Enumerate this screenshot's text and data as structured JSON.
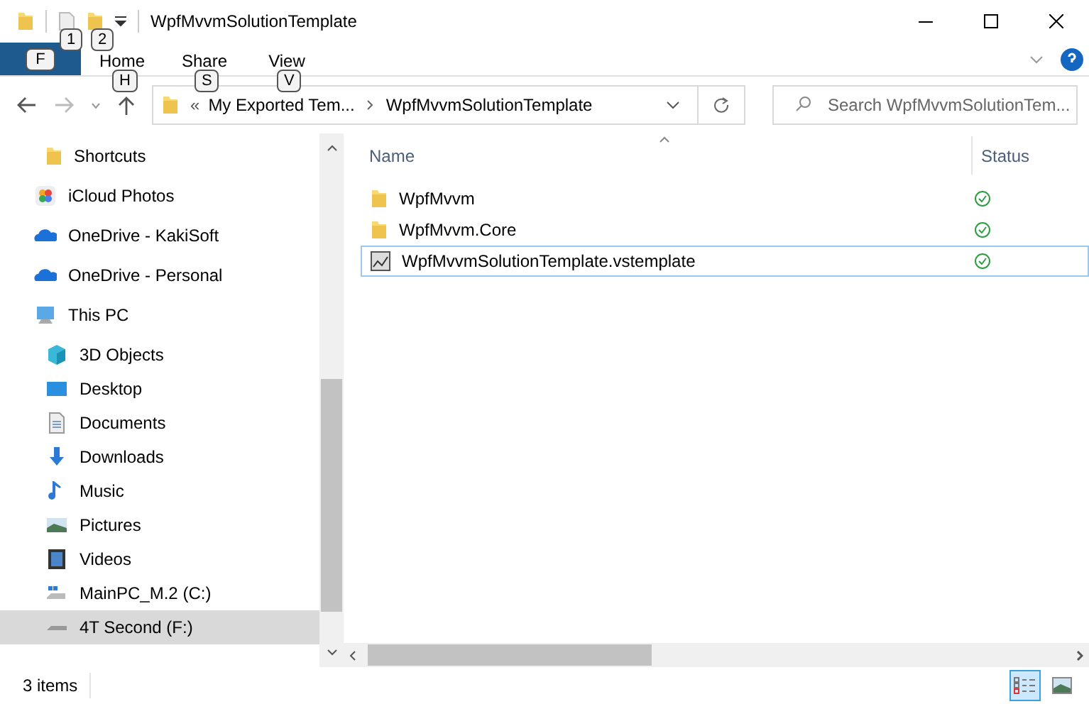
{
  "window": {
    "title": "WpfMvvmSolutionTemplate"
  },
  "quick_access_keytips": [
    "1",
    "2"
  ],
  "ribbon": {
    "tabs": [
      {
        "kind": "file",
        "keytip": "F"
      },
      {
        "kind": "tab",
        "label": "Home",
        "keytip": "H"
      },
      {
        "kind": "tab",
        "label": "Share",
        "keytip": "S"
      },
      {
        "kind": "tab",
        "label": "View",
        "keytip": "V"
      }
    ]
  },
  "address": {
    "prefix": "«",
    "path": [
      "My Exported Tem...",
      "WpfMvvmSolutionTemplate"
    ]
  },
  "search": {
    "placeholder": "Search WpfMvvmSolutionTem..."
  },
  "nav": [
    {
      "children": [
        {
          "kind": "folder",
          "label": "Shortcuts",
          "selected": false
        }
      ]
    },
    {
      "kind": "photos",
      "label": "iCloud Photos",
      "selected": false
    },
    {
      "kind": "cloud",
      "label": "OneDrive - KakiSoft",
      "selected": false
    },
    {
      "kind": "cloud",
      "label": "OneDrive - Personal",
      "selected": false
    },
    {
      "kind": "pc",
      "label": "This PC",
      "selected": false,
      "children": [
        {
          "kind": "cube",
          "label": "3D Objects",
          "selected": false
        },
        {
          "kind": "desktop",
          "label": "Desktop",
          "selected": false
        },
        {
          "kind": "doc",
          "label": "Documents",
          "selected": false
        },
        {
          "kind": "download",
          "label": "Downloads",
          "selected": false
        },
        {
          "kind": "music",
          "label": "Music",
          "selected": false
        },
        {
          "kind": "pictures",
          "label": "Pictures",
          "selected": false
        },
        {
          "kind": "videos",
          "label": "Videos",
          "selected": false
        },
        {
          "kind": "drive_os",
          "label": "MainPC_M.2 (C:)",
          "selected": false
        },
        {
          "kind": "drive",
          "label": "4T Second (F:)",
          "selected": true
        }
      ]
    }
  ],
  "table": {
    "columns": [
      "Name",
      "Status"
    ],
    "rows": [
      {
        "kind": "folder",
        "name": "WpfMvvm",
        "focused": false
      },
      {
        "kind": "folder",
        "name": "WpfMvvm.Core",
        "focused": false
      },
      {
        "kind": "file",
        "name": "WpfMvvmSolutionTemplate.vstemplate",
        "focused": true
      }
    ]
  },
  "status_bar": {
    "text": "3 items",
    "views": [
      {
        "kind": "details",
        "selected": true
      },
      {
        "kind": "large",
        "selected": false
      }
    ]
  }
}
